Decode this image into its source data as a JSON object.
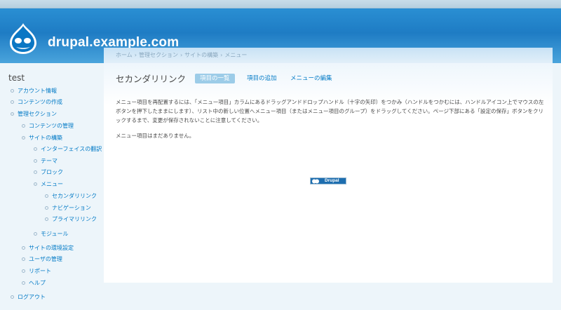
{
  "site": {
    "name": "drupal.example.com"
  },
  "breadcrumb": [
    "ホーム",
    "管理セクション",
    "サイトの構築",
    "メニュー"
  ],
  "page": {
    "title": "セカンダリリンク",
    "tabs": [
      {
        "label": "項目の一覧",
        "active": true
      },
      {
        "label": "項目の追加",
        "active": false
      },
      {
        "label": "メニューの編集",
        "active": false
      }
    ],
    "help_text": "メニュー項目を再配置するには、「メニュー項目」カラムにあるドラッグアンドドロップハンドル（十字の矢印）をつかみ（ハンドルをつかむには、ハンドルアイコン上でマウスの左ボタンを押下したままにします）、リスト中の新しい位置へメニュー項目（またはメニュー項目のグループ）をドラッグしてください。ページ下部にある「設定の保存」ボタンをクリックするまで、変更が保存されないことに注意してください。",
    "empty_text": "メニュー項目はまだありません。",
    "powered_by": "Drupal"
  },
  "sidebar": {
    "title": "test",
    "items": [
      {
        "label": "アカウント情報",
        "level": 0
      },
      {
        "label": "コンテンツの作成",
        "level": 0
      },
      {
        "label": "管理セクション",
        "level": 0
      },
      {
        "label": "コンテンツの管理",
        "level": 1
      },
      {
        "label": "サイトの構築",
        "level": 1
      },
      {
        "label": "インターフェイスの翻訳",
        "level": 2
      },
      {
        "label": "テーマ",
        "level": 2
      },
      {
        "label": "ブロック",
        "level": 2
      },
      {
        "label": "メニュー",
        "level": 2
      },
      {
        "label": "セカンダリリンク",
        "level": 3
      },
      {
        "label": "ナビゲーション",
        "level": 3
      },
      {
        "label": "プライマリリンク",
        "level": 3
      },
      {
        "label": "モジュール",
        "level": 2
      },
      {
        "label": "サイトの環境設定",
        "level": 1
      },
      {
        "label": "ユーザの管理",
        "level": 1
      },
      {
        "label": "リポート",
        "level": 1
      },
      {
        "label": "ヘルプ",
        "level": 1
      },
      {
        "label": "ログアウト",
        "level": 0
      }
    ]
  },
  "colors": {
    "header": "#1e7cc4",
    "link": "#027ac6",
    "active_tab": "#9ccce8",
    "page_bg": "#edf5fa"
  }
}
